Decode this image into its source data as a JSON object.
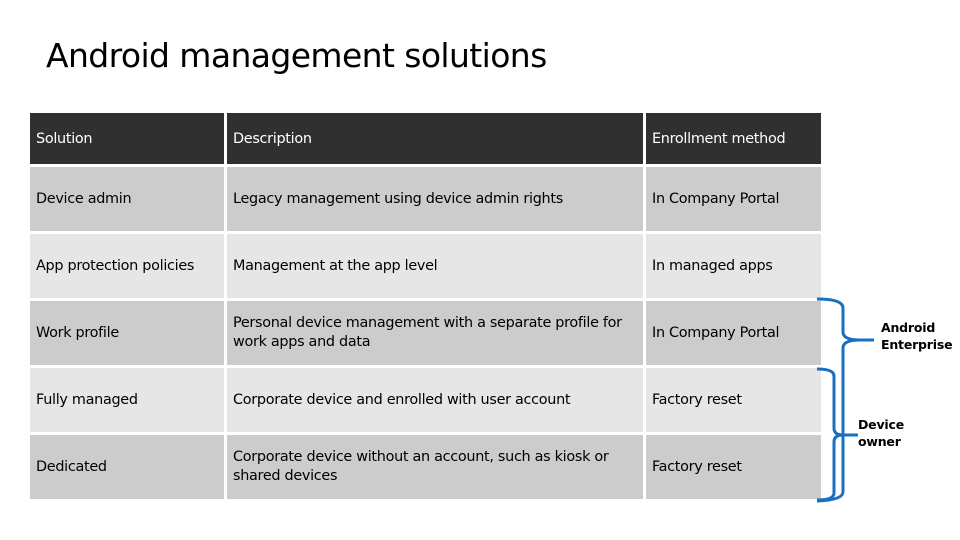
{
  "title": "Android management solutions",
  "table": {
    "headers": [
      "Solution",
      "Description",
      "Enrollment method"
    ],
    "rows": [
      {
        "solution": "Device admin",
        "description": "Legacy management using device admin rights",
        "enrollment": "In Company Portal"
      },
      {
        "solution": "App protection policies",
        "description": "Management at the app level",
        "enrollment": "In managed apps"
      },
      {
        "solution": "Work profile",
        "description": "Personal device management with a separate profile for work apps and data",
        "enrollment": "In Company Portal"
      },
      {
        "solution": "Fully managed",
        "description": "Corporate device and enrolled with user account",
        "enrollment": "Factory reset"
      },
      {
        "solution": "Dedicated",
        "description": "Corporate device without an account, such as kiosk or shared devices",
        "enrollment": "Factory reset"
      }
    ]
  },
  "annotations": {
    "android_enterprise": "Android Enterprise",
    "device_owner": "Device owner",
    "brace_color": "#1a6fc0"
  },
  "colors": {
    "header_bg": "#303030",
    "row_dark": "#cccccc",
    "row_light": "#e6e6e6"
  }
}
